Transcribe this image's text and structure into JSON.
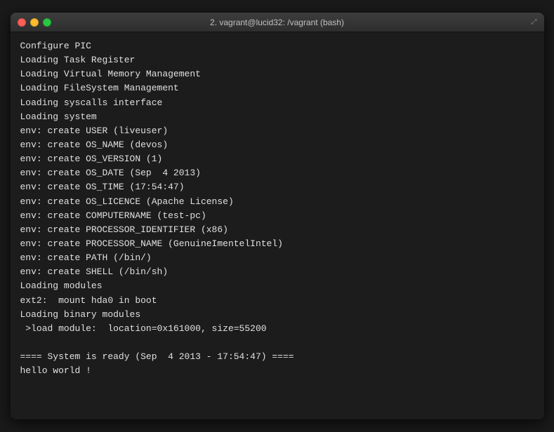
{
  "window": {
    "title": "2. vagrant@lucid32: /vagrant (bash)"
  },
  "terminal": {
    "lines": [
      {
        "id": "l1",
        "text": "Configure PIC"
      },
      {
        "id": "l2",
        "text": "Loading Task Register"
      },
      {
        "id": "l3",
        "text": "Loading Virtual Memory Management"
      },
      {
        "id": "l4",
        "text": "Loading FileSystem Management"
      },
      {
        "id": "l5",
        "text": "Loading syscalls interface"
      },
      {
        "id": "l6",
        "text": "Loading system"
      },
      {
        "id": "l7",
        "text": "env: create USER (liveuser)"
      },
      {
        "id": "l8",
        "text": "env: create OS_NAME (devos)"
      },
      {
        "id": "l9",
        "text": "env: create OS_VERSION (1)"
      },
      {
        "id": "l10",
        "text": "env: create OS_DATE (Sep  4 2013)"
      },
      {
        "id": "l11",
        "text": "env: create OS_TIME (17:54:47)"
      },
      {
        "id": "l12",
        "text": "env: create OS_LICENCE (Apache License)"
      },
      {
        "id": "l13",
        "text": "env: create COMPUTERNAME (test-pc)"
      },
      {
        "id": "l14",
        "text": "env: create PROCESSOR_IDENTIFIER (x86)"
      },
      {
        "id": "l15",
        "text": "env: create PROCESSOR_NAME (GenuineImentelIntel)"
      },
      {
        "id": "l16",
        "text": "env: create PATH (/bin/)"
      },
      {
        "id": "l17",
        "text": "env: create SHELL (/bin/sh)"
      },
      {
        "id": "l18",
        "text": "Loading modules"
      },
      {
        "id": "l19",
        "text": "ext2:  mount hda0 in boot"
      },
      {
        "id": "l20",
        "text": "Loading binary modules"
      },
      {
        "id": "l21",
        "text": " >load module:  location=0x161000, size=55200"
      },
      {
        "id": "l22",
        "text": ""
      },
      {
        "id": "l23",
        "text": "==== System is ready (Sep  4 2013 - 17:54:47) ===="
      },
      {
        "id": "l24",
        "text": "hello world !"
      }
    ]
  }
}
